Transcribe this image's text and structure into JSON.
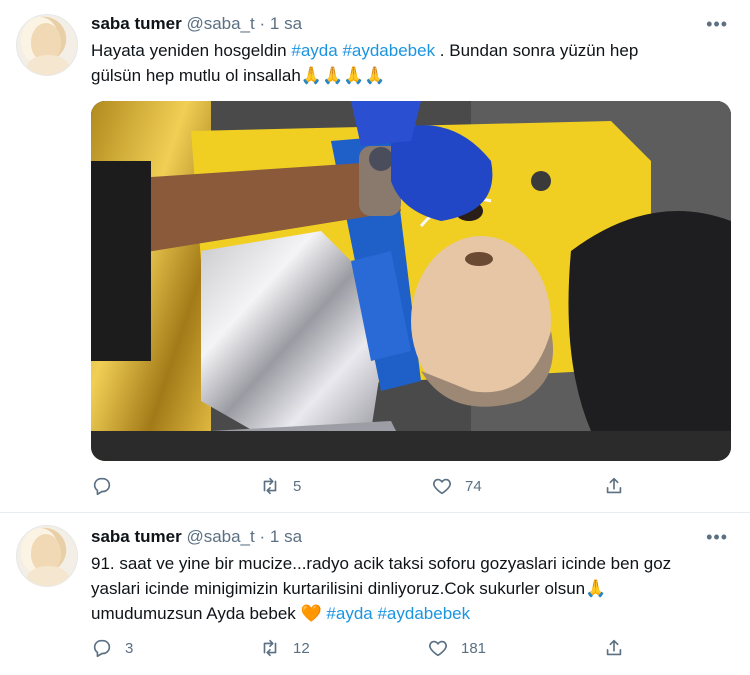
{
  "tweets": [
    {
      "name": "saba tumer",
      "handle": "@saba_t",
      "dot": "·",
      "time": "1 sa",
      "more": "•••",
      "text_line1_a": "Hayata yeniden hosgeldin ",
      "hashtag1": "#ayda",
      "hashtag2": "#aydabebek",
      "text_line1_b": " . Bundan sonra yüzün hep",
      "text_line2": "gülsün hep mutlu ol insallah",
      "emoji": "🙏🙏🙏🙏",
      "reply_count": "",
      "retweet_count": "5",
      "like_count": "74"
    },
    {
      "name": "saba tumer",
      "handle": "@saba_t",
      "dot": "·",
      "time": "1 sa",
      "more": "•••",
      "text_line1": "91. saat ve yine bir mucize...radyo acik taksi soforu gozyaslari icinde ben goz",
      "text_line2": "yaslari icinde minigimizin kurtarilisini dinliyoruz.Cok sukurler olsun",
      "emoji1": "🙏",
      "text_line3": "umudumuzsun Ayda bebek ",
      "heart_emoji": "🧡",
      "hashtag1": "#ayda",
      "hashtag2": "#aydabebek",
      "reply_count": "3",
      "retweet_count": "12",
      "like_count": "181"
    }
  ],
  "colors": {
    "hashtag": "#1b95e0",
    "secondary": "#5b7083"
  },
  "icons": [
    "reply-icon",
    "retweet-icon",
    "like-icon",
    "share-icon",
    "more-icon"
  ]
}
